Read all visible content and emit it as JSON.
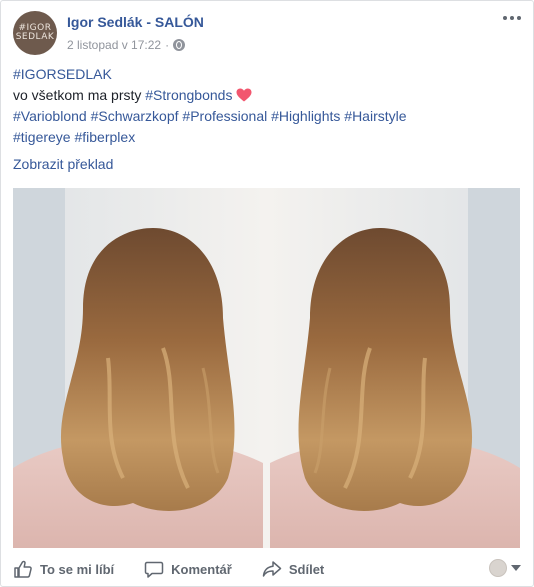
{
  "post": {
    "page_name": "Igor Sedlák - SALÓN",
    "avatar_text_top": "#IGOR",
    "avatar_text_bottom": "SEDLAK",
    "timestamp": "2 listopad v 17:22",
    "privacy_icon": "globe-icon",
    "more_icon": "more-options-icon",
    "line1_tag": "#IGORSEDLAK",
    "line2_text": "vo všetkom ma prsty ",
    "line2_tag": "#Strongbonds",
    "heart_icon": "heart-emoji-icon",
    "line3_tags": [
      "#Varioblond",
      "#Schwarzkopf",
      "#Professional",
      "#Highlights",
      "#Hairstyle"
    ],
    "line4_tags": [
      "#tigereye",
      "#fiberplex"
    ],
    "translate_label": "Zobrazit překlad"
  },
  "actions": {
    "like_label": "To se mi líbí",
    "comment_label": "Komentář",
    "share_label": "Sdílet",
    "like_icon": "thumbs-up-icon",
    "comment_icon": "comment-bubble-icon",
    "share_icon": "share-arrow-icon"
  },
  "colors": {
    "link": "#365899",
    "secondary_text": "#90949c",
    "action_text": "#606770",
    "hair": "#9b6b3e",
    "shirt": "#e3c3bd"
  }
}
